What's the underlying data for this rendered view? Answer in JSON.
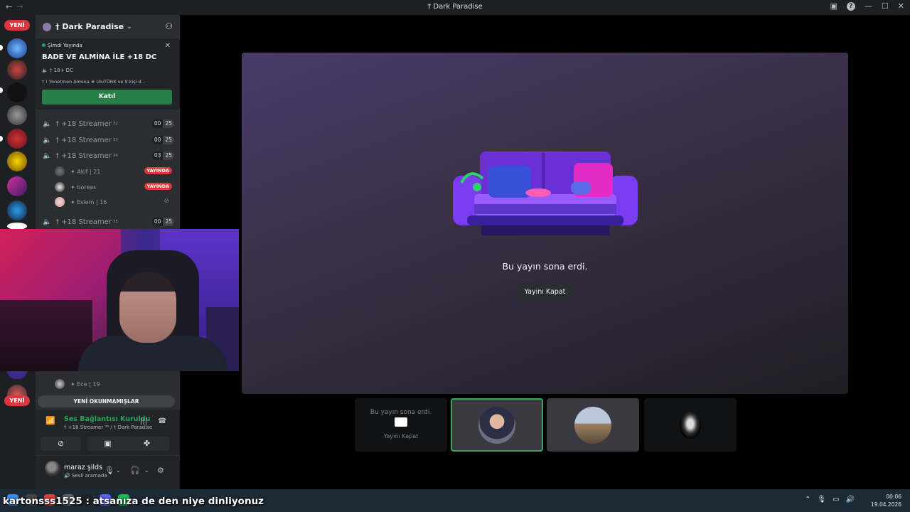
{
  "window": {
    "title": "† Dark Paradise",
    "nav_back": "←",
    "nav_forward": "→"
  },
  "rail": {
    "new_badge_top": "YENİ",
    "new_badge_bottom": "YENİ"
  },
  "server": {
    "name": "† Dark Paradise"
  },
  "live_card": {
    "status": "Şimdi Yayında",
    "title": "BADE VE ALMİNA İLE +18 DC",
    "channel": "† 18+ DC",
    "participants": "† ! Yonetmen Almina # UluTÜRK ve 9 kişi d...",
    "join_label": "Katıl"
  },
  "voice_channels": [
    {
      "name": "† +18 Streamer",
      "sup": "32",
      "count": "00",
      "limit": "25"
    },
    {
      "name": "† +18 Streamer",
      "sup": "33",
      "count": "00",
      "limit": "25"
    },
    {
      "name": "† +18 Streamer",
      "sup": "34",
      "count": "03",
      "limit": "25"
    },
    {
      "name": "† +18 Streamer",
      "sup": "35",
      "count": "00",
      "limit": "25"
    }
  ],
  "members": [
    {
      "name": "✦ Akif | 21",
      "tag": "YAYINDA"
    },
    {
      "name": "✦ boreas",
      "tag": "YAYINDA"
    },
    {
      "name": "✦ Eslem | 16",
      "tag": ""
    },
    {
      "name": "✦ Ece | 19",
      "tag": ""
    }
  ],
  "unread_label": "YENİ OKUNMAMIŞLAR",
  "voice_status": {
    "title": "Ses Bağlantısı Kuruldu",
    "subtitle": "† +18 Streamer ³⁴ / † Dark Paradise"
  },
  "user": {
    "name": "maraz şilds",
    "status": "Sesli aramada"
  },
  "stage": {
    "message": "Bu yayın sona erdi.",
    "close_label": "Yayını Kapat"
  },
  "thumb_ended": {
    "message": "Bu yayın sona erdi.",
    "close_label": "Yayını Kapat"
  },
  "caption": "kartonsss1525 : atsanıza de den niye dinliyonuz",
  "clock": {
    "time": "00:06",
    "date": "19.04.2026"
  },
  "colors": {
    "accent_green": "#23a55a",
    "badge_red": "#da373c",
    "panel": "#2b2d31"
  }
}
